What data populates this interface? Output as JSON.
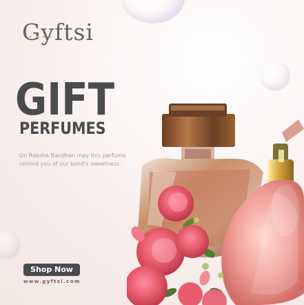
{
  "brand": {
    "logo_text": "Gyftsi"
  },
  "hero": {
    "headline": "GIFT",
    "subheadline": "PERFUMES",
    "tagline": "On Raksha Bandhan may this perfume remind you of our bond's sweetness."
  },
  "actions": {
    "shop_now": "Shop Now"
  },
  "footer": {
    "website": "www.gyftsi.com"
  },
  "colors": {
    "background": "#fbf3f1",
    "text_dark": "#4a4b4e",
    "text_muted": "#a59d9a",
    "accent_gold": "#d9b23f",
    "rose": "#e85b6c",
    "bottle_pink": "#f2a09a"
  },
  "icons": {
    "flowers": "rose-bouquet",
    "bottles": "perfume-bottles"
  }
}
